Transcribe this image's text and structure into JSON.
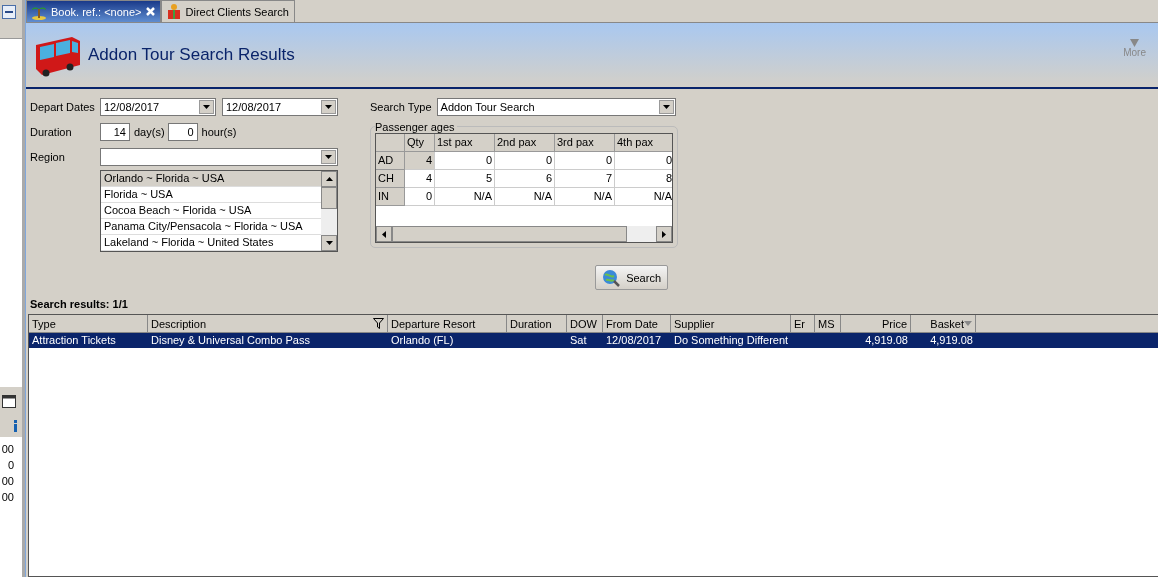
{
  "side_panel": {
    "values": [
      "00",
      "0",
      "00",
      "00"
    ]
  },
  "tabs": [
    {
      "label": "Book. ref.: <none>",
      "selected": true,
      "closable": true
    },
    {
      "label": "Direct Clients Search",
      "selected": false,
      "closable": false
    }
  ],
  "header": {
    "title": "Addon Tour Search Results",
    "more_label": "More"
  },
  "form": {
    "depart_label": "Depart Dates",
    "depart_from": "12/08/2017",
    "depart_to": "12/08/2017",
    "duration_label": "Duration",
    "days": "14",
    "days_unit": "day(s)",
    "hours": "0",
    "hours_unit": "hour(s)",
    "region_label": "Region",
    "region_options": [
      {
        "label": "Orlando ~ Florida ~ USA",
        "selected": true
      },
      {
        "label": "Florida ~ USA",
        "selected": false
      },
      {
        "label": "Cocoa Beach ~ Florida ~ USA",
        "selected": false
      },
      {
        "label": "Panama City/Pensacola ~  Florida  ~ USA",
        "selected": false
      },
      {
        "label": "Lakeland ~ Florida ~ United States",
        "selected": false
      }
    ],
    "search_type_label": "Search Type",
    "search_type": "Addon Tour Search"
  },
  "passenger_ages": {
    "title": "Passenger ages",
    "columns": [
      "Qty",
      "1st pax",
      "2nd pax",
      "3rd pax",
      "4th pax"
    ],
    "rows": [
      {
        "label": "AD",
        "cells": [
          "4",
          "0",
          "0",
          "0",
          "0"
        ],
        "focused": true
      },
      {
        "label": "CH",
        "cells": [
          "4",
          "5",
          "6",
          "7",
          "8"
        ],
        "focused": false
      },
      {
        "label": "IN",
        "cells": [
          "0",
          "N/A",
          "N/A",
          "N/A",
          "N/A"
        ],
        "focused": false
      }
    ]
  },
  "search_button": "Search",
  "results": {
    "summary": "Search results: 1/1",
    "columns": [
      {
        "label": "Type",
        "kind": "text"
      },
      {
        "label": "Description",
        "kind": "text",
        "filter": true
      },
      {
        "label": "Departure Resort",
        "kind": "text"
      },
      {
        "label": "Duration",
        "kind": "text"
      },
      {
        "label": "DOW",
        "kind": "text"
      },
      {
        "label": "From Date",
        "kind": "text"
      },
      {
        "label": "Supplier",
        "kind": "text"
      },
      {
        "label": "Er",
        "kind": "text"
      },
      {
        "label": "MS",
        "kind": "text"
      },
      {
        "label": "Price",
        "kind": "amount"
      },
      {
        "label": "Basket",
        "kind": "amount",
        "sort": true
      }
    ],
    "rows": [
      {
        "cells": [
          "Attraction Tickets",
          "Disney & Universal Combo Pass",
          "Orlando (FL)",
          "",
          "Sat",
          "12/08/2017",
          "Do Something Different",
          "",
          "",
          "4,919.08",
          "4,919.08"
        ],
        "selected": true
      }
    ]
  }
}
